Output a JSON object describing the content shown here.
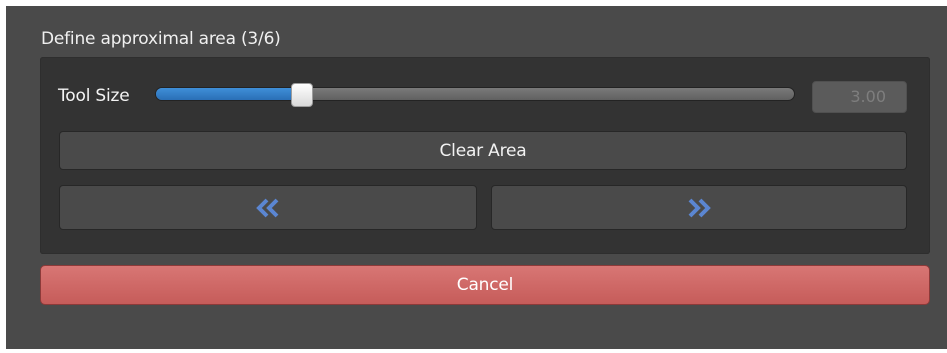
{
  "group": {
    "title": "Define approximal area (3/6)"
  },
  "tool_size": {
    "label": "Tool Size",
    "value_text": "3.00",
    "slider_fraction": 0.23
  },
  "buttons": {
    "clear_label": "Clear Area",
    "prev_icon": "double-chevron-left-icon",
    "next_icon": "double-chevron-right-icon",
    "cancel_label": "Cancel"
  },
  "colors": {
    "window_bg": "#4a4a4a",
    "panel_bg": "#333333",
    "slider_fill": "#2f7fcc",
    "arrow_blue": "#5b86d2",
    "cancel_red": "#d06866"
  }
}
